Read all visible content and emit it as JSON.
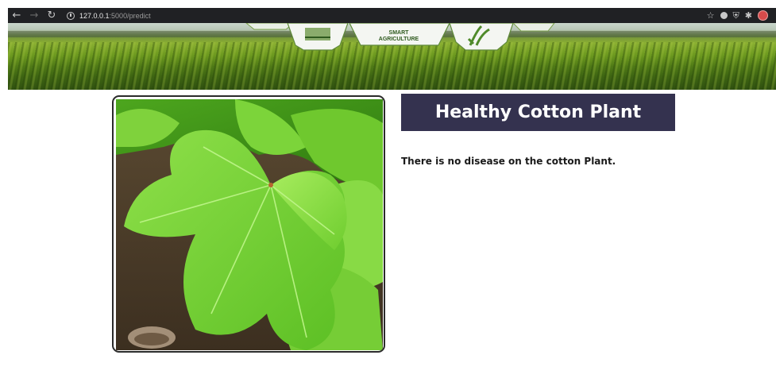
{
  "browser": {
    "back_icon": "back-arrow-icon",
    "forward_icon": "forward-arrow-icon",
    "reload_icon": "reload-icon",
    "url_host": "127.0.0.1",
    "url_path": ":5000/predict",
    "star_icon": "star-icon",
    "extension_icons": [
      "extension-icon",
      "shield-icon",
      "puzzle-icon"
    ],
    "profile_icon": "profile-avatar-icon"
  },
  "banner": {
    "logo_line1": "SMART",
    "logo_line2": "AGRICULTURE"
  },
  "result": {
    "title": "Healthy Cotton Plant",
    "description": "There is no disease on the cotton Plant."
  },
  "colors": {
    "title_bg": "#34324f",
    "title_text": "#ffffff",
    "toolbar_bg": "#202124"
  }
}
